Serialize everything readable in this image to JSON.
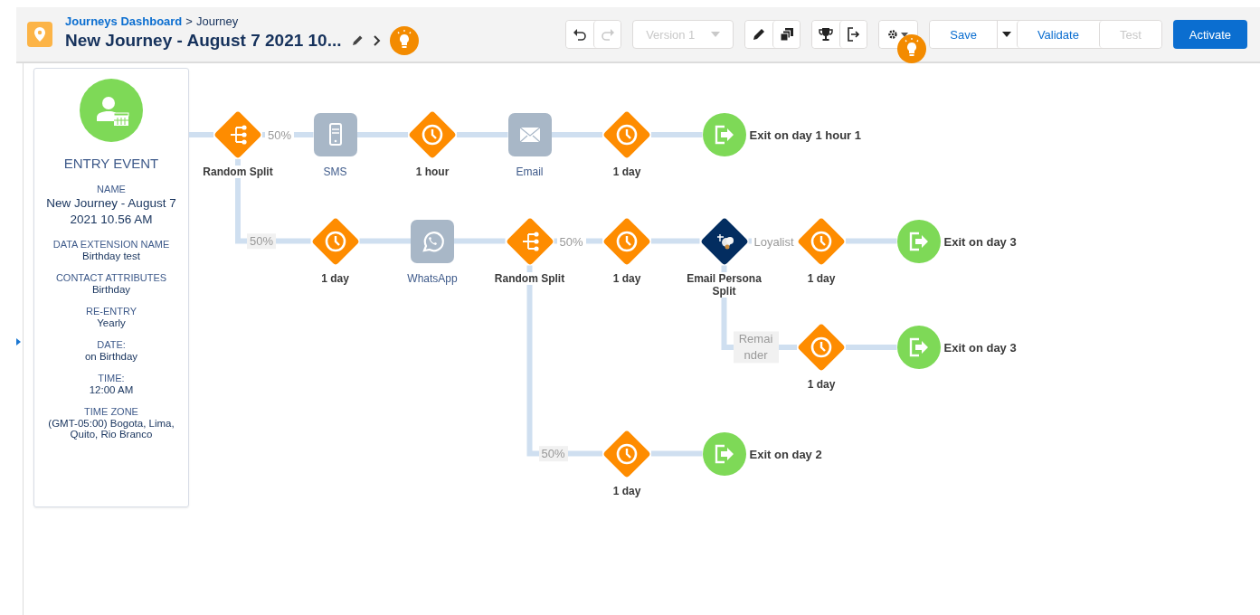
{
  "header": {
    "breadcrumb": {
      "link": "Journeys Dashboard",
      "separator": ">",
      "current": "Journey"
    },
    "title": "New Journey - August 7 2021 10...",
    "history": [
      {
        "kind": "undo",
        "disabled": false
      },
      {
        "kind": "redo",
        "disabled": true
      }
    ],
    "version": {
      "label": "Version 1",
      "disabled": true
    },
    "actions": [
      {
        "label": "Save",
        "disabled": false
      },
      {
        "label": "Validate",
        "disabled": false
      },
      {
        "label": "Test",
        "disabled": true
      }
    ],
    "activate": "Activate"
  },
  "entry_event": {
    "title": "ENTRY EVENT",
    "fields": [
      {
        "label": "NAME",
        "value": "New Journey - August 7 2021 10.56 AM"
      },
      {
        "label": "DATA EXTENSION NAME",
        "value": "Birthday test"
      },
      {
        "label": "CONTACT ATTRIBUTES",
        "value": "Birthday"
      },
      {
        "label": "RE-ENTRY",
        "value": "Yearly"
      },
      {
        "label": "DATE:",
        "value": "on Birthday"
      },
      {
        "label": "TIME:",
        "value": "12:00 AM"
      },
      {
        "label": "TIME ZONE",
        "value": "(GMT-05:00) Bogota, Lima, Quito, Rio Branco"
      }
    ]
  },
  "flow": {
    "steps": [
      {
        "kind": "split",
        "label": "Random Split",
        "branches": [
          {
            "label": "50%",
            "steps": [
              {
                "kind": "sms",
                "label": "SMS"
              },
              {
                "kind": "wait",
                "label": "1 hour"
              },
              {
                "kind": "email",
                "label": "Email"
              },
              {
                "kind": "wait",
                "label": "1 day"
              },
              {
                "kind": "exit",
                "label": "Exit on day 1 hour 1"
              }
            ]
          },
          {
            "label": "50%",
            "steps": [
              {
                "kind": "wait",
                "label": "1 day"
              },
              {
                "kind": "whatsapp",
                "label": "WhatsApp"
              },
              {
                "kind": "split",
                "label": "Random Split",
                "branches": [
                  {
                    "label": "50%",
                    "steps": [
                      {
                        "kind": "wait",
                        "label": "1 day"
                      },
                      {
                        "kind": "persona_split",
                        "label": "Email Persona Split",
                        "branches": [
                          {
                            "label": "Loyalist",
                            "steps": [
                              {
                                "kind": "wait",
                                "label": "1 day"
                              },
                              {
                                "kind": "exit",
                                "label": "Exit on day 3"
                              }
                            ]
                          },
                          {
                            "label": "Remainder",
                            "steps": [
                              {
                                "kind": "wait",
                                "label": "1 day"
                              },
                              {
                                "kind": "exit",
                                "label": "Exit on day 3"
                              }
                            ]
                          }
                        ]
                      }
                    ]
                  },
                  {
                    "label": "50%",
                    "steps": [
                      {
                        "kind": "wait",
                        "label": "1 day"
                      },
                      {
                        "kind": "exit",
                        "label": "Exit on day 2"
                      }
                    ]
                  }
                ]
              }
            ]
          }
        ]
      }
    ]
  }
}
